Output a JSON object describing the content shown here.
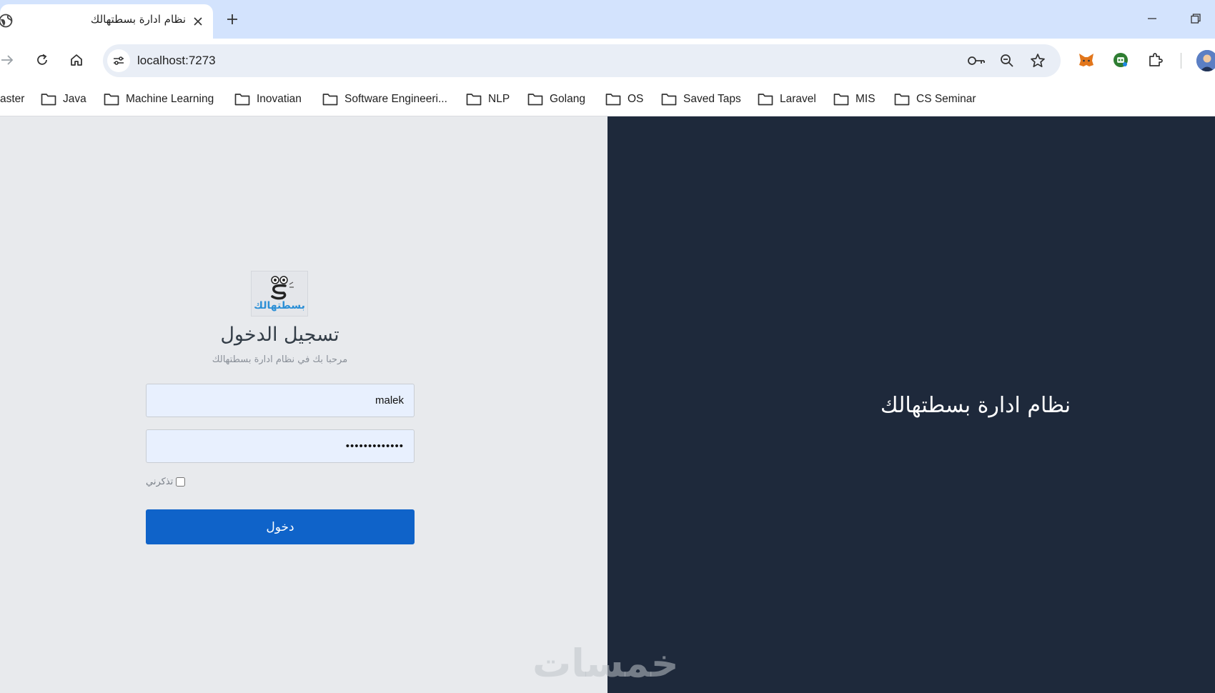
{
  "browser": {
    "tab_title": "نظام ادارة بسطتهالك",
    "url": "localhost:7273",
    "bookmarks": [
      "aster",
      "Java",
      "Machine Learning",
      "Inovatian",
      "Software Engineeri...",
      "NLP",
      "Golang",
      "OS",
      "Saved Taps",
      "Laravel",
      "MIS",
      "CS Seminar"
    ]
  },
  "login": {
    "logo_text": "بسطتهالك",
    "title": "تسجيل الدخول",
    "subtitle": "مرحبا بك في نظام ادارة بسطتهالك",
    "username_value": "malek",
    "password_value": "•••••••••••••",
    "remember_label": "تذكرني",
    "submit_label": "دخول"
  },
  "panel": {
    "title": "نظام ادارة بسطتهالك"
  },
  "watermark": "خمسات",
  "colors": {
    "tab_strip": "#d3e3fd",
    "right_panel": "#1e293b",
    "primary_button": "#0f63c9",
    "left_panel": "#e8eaed"
  }
}
